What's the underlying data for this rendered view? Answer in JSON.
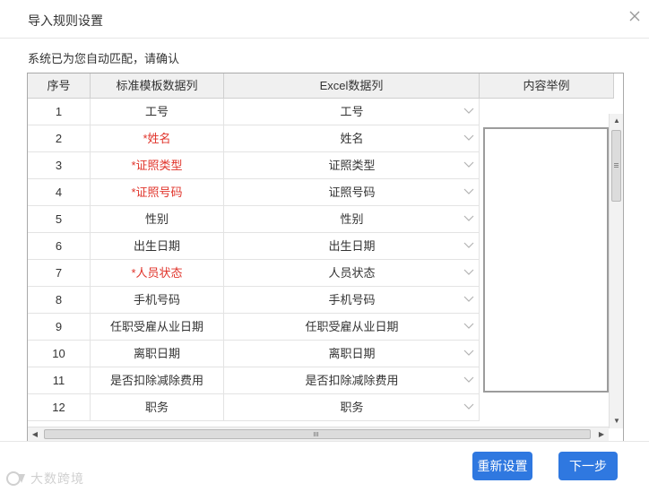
{
  "dialog": {
    "title": "导入规则设置",
    "close_icon": "close-icon"
  },
  "hint": "系统已为您自动匹配，请确认",
  "table": {
    "headers": {
      "index": "序号",
      "standard": "标准模板数据列",
      "excel": "Excel数据列",
      "example": "内容举例"
    },
    "rows": [
      {
        "index": "1",
        "standard": "工号",
        "required": false,
        "excel": "工号"
      },
      {
        "index": "2",
        "standard": "*姓名",
        "required": true,
        "excel": "姓名"
      },
      {
        "index": "3",
        "standard": "*证照类型",
        "required": true,
        "excel": "证照类型"
      },
      {
        "index": "4",
        "standard": "*证照号码",
        "required": true,
        "excel": "证照号码"
      },
      {
        "index": "5",
        "standard": "性别",
        "required": false,
        "excel": "性别"
      },
      {
        "index": "6",
        "standard": "出生日期",
        "required": false,
        "excel": "出生日期"
      },
      {
        "index": "7",
        "standard": "*人员状态",
        "required": true,
        "excel": "人员状态"
      },
      {
        "index": "8",
        "standard": "手机号码",
        "required": false,
        "excel": "手机号码"
      },
      {
        "index": "9",
        "standard": "任职受雇从业日期",
        "required": false,
        "excel": "任职受雇从业日期"
      },
      {
        "index": "10",
        "standard": "离职日期",
        "required": false,
        "excel": "离职日期"
      },
      {
        "index": "11",
        "standard": "是否扣除减除费用",
        "required": false,
        "excel": "是否扣除减除费用"
      },
      {
        "index": "12",
        "standard": "职务",
        "required": false,
        "excel": "职务"
      }
    ],
    "dropdown_icon": "chevron-down-icon"
  },
  "buttons": {
    "reset": "重新设置",
    "next": "下一步"
  },
  "watermark": "大数跨境",
  "colors": {
    "primary": "#2f78e0",
    "required_text": "#e0332a",
    "header_bg": "#f0f0f0"
  }
}
